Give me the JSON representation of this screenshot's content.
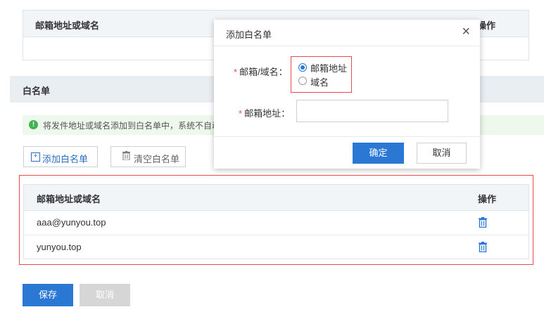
{
  "top_table": {
    "col_address": "邮箱地址或域名",
    "col_action": "操作"
  },
  "section": {
    "title": "白名单"
  },
  "tip": {
    "icon": "!",
    "text": "将发件地址或域名添加到白名单中，系统不自动"
  },
  "actions": {
    "add_icon": "+",
    "add_label": "添加白名单",
    "clear_icon": "🗑",
    "clear_label": "清空白名单"
  },
  "whitelist": {
    "col_address": "邮箱地址或域名",
    "col_action": "操作",
    "rows": [
      {
        "value": "aaa@yunyou.top"
      },
      {
        "value": "yunyou.top"
      }
    ]
  },
  "footer": {
    "save_label": "保存",
    "cancel_label": "取消"
  },
  "modal": {
    "title": "添加白名单",
    "close_symbol": "×",
    "required_mark": "*",
    "type_label": "邮箱/域名：",
    "type_options": [
      {
        "label": "邮箱地址",
        "selected": true
      },
      {
        "label": "域名",
        "selected": false
      }
    ],
    "address_label": "邮箱地址：",
    "address_value": "",
    "ok_label": "确定",
    "cancel_label": "取消"
  },
  "colors": {
    "primary": "#2a78d4",
    "danger": "#e74c4c",
    "success": "#3fb34f"
  }
}
